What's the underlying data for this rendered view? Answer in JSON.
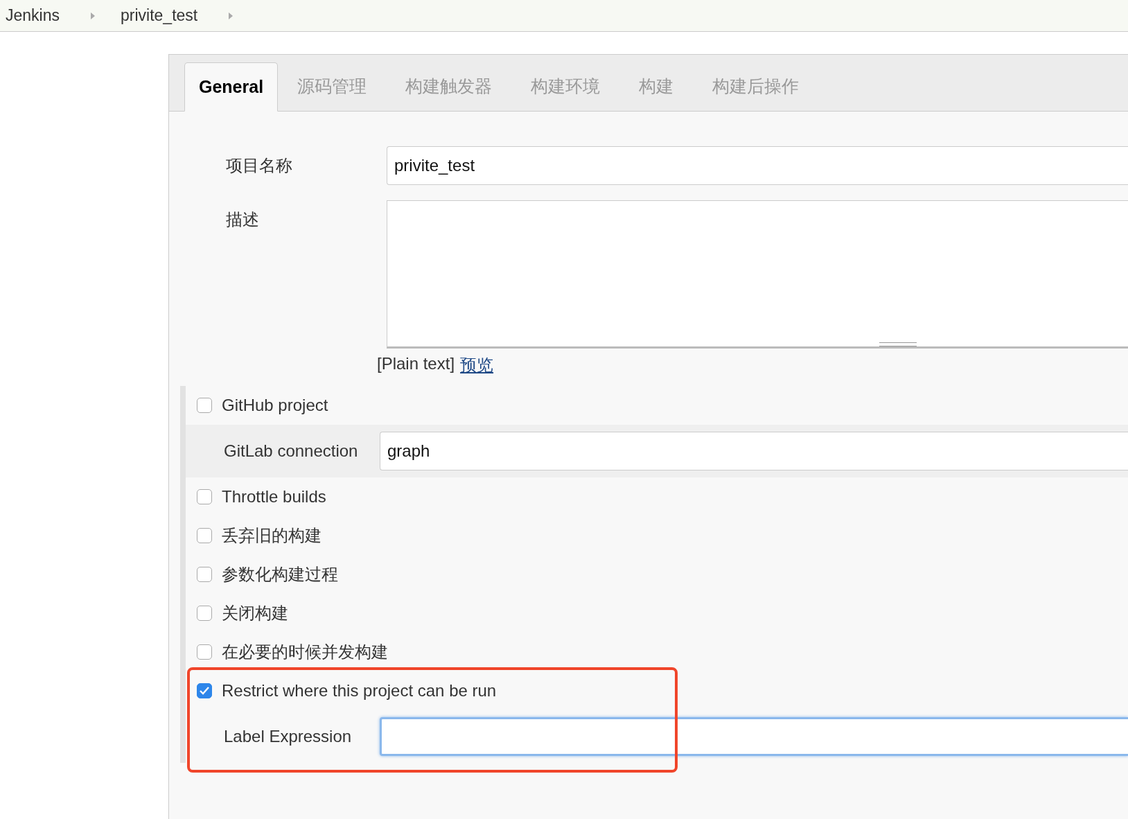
{
  "breadcrumbs": [
    {
      "label": "Jenkins"
    },
    {
      "label": "privite_test"
    }
  ],
  "tabs": [
    {
      "label": "General",
      "selected": true
    },
    {
      "label": "源码管理",
      "selected": false
    },
    {
      "label": "构建触发器",
      "selected": false
    },
    {
      "label": "构建环境",
      "selected": false
    },
    {
      "label": "构建",
      "selected": false
    },
    {
      "label": "构建后操作",
      "selected": false
    }
  ],
  "project_name": {
    "label": "项目名称",
    "value": "privite_test"
  },
  "description": {
    "label": "描述",
    "format_note": "[Plain text]",
    "preview_link": "预览"
  },
  "options": [
    {
      "kind": "checkbox",
      "label": "GitHub project",
      "checked": false
    },
    {
      "kind": "field",
      "label": "GitLab connection",
      "value": "graph",
      "focused": false
    },
    {
      "kind": "checkbox",
      "label": "Throttle builds",
      "checked": false
    },
    {
      "kind": "checkbox",
      "label": "丢弃旧的构建",
      "checked": false
    },
    {
      "kind": "checkbox",
      "label": "参数化构建过程",
      "checked": false
    },
    {
      "kind": "checkbox",
      "label": "关闭构建",
      "checked": false
    },
    {
      "kind": "checkbox",
      "label": "在必要的时候并发构建",
      "checked": false
    }
  ],
  "highlighted_options": [
    {
      "kind": "checkbox",
      "label": "Restrict where this project can be run",
      "checked": true
    },
    {
      "kind": "field",
      "label": "Label Expression",
      "focused": true
    }
  ]
}
